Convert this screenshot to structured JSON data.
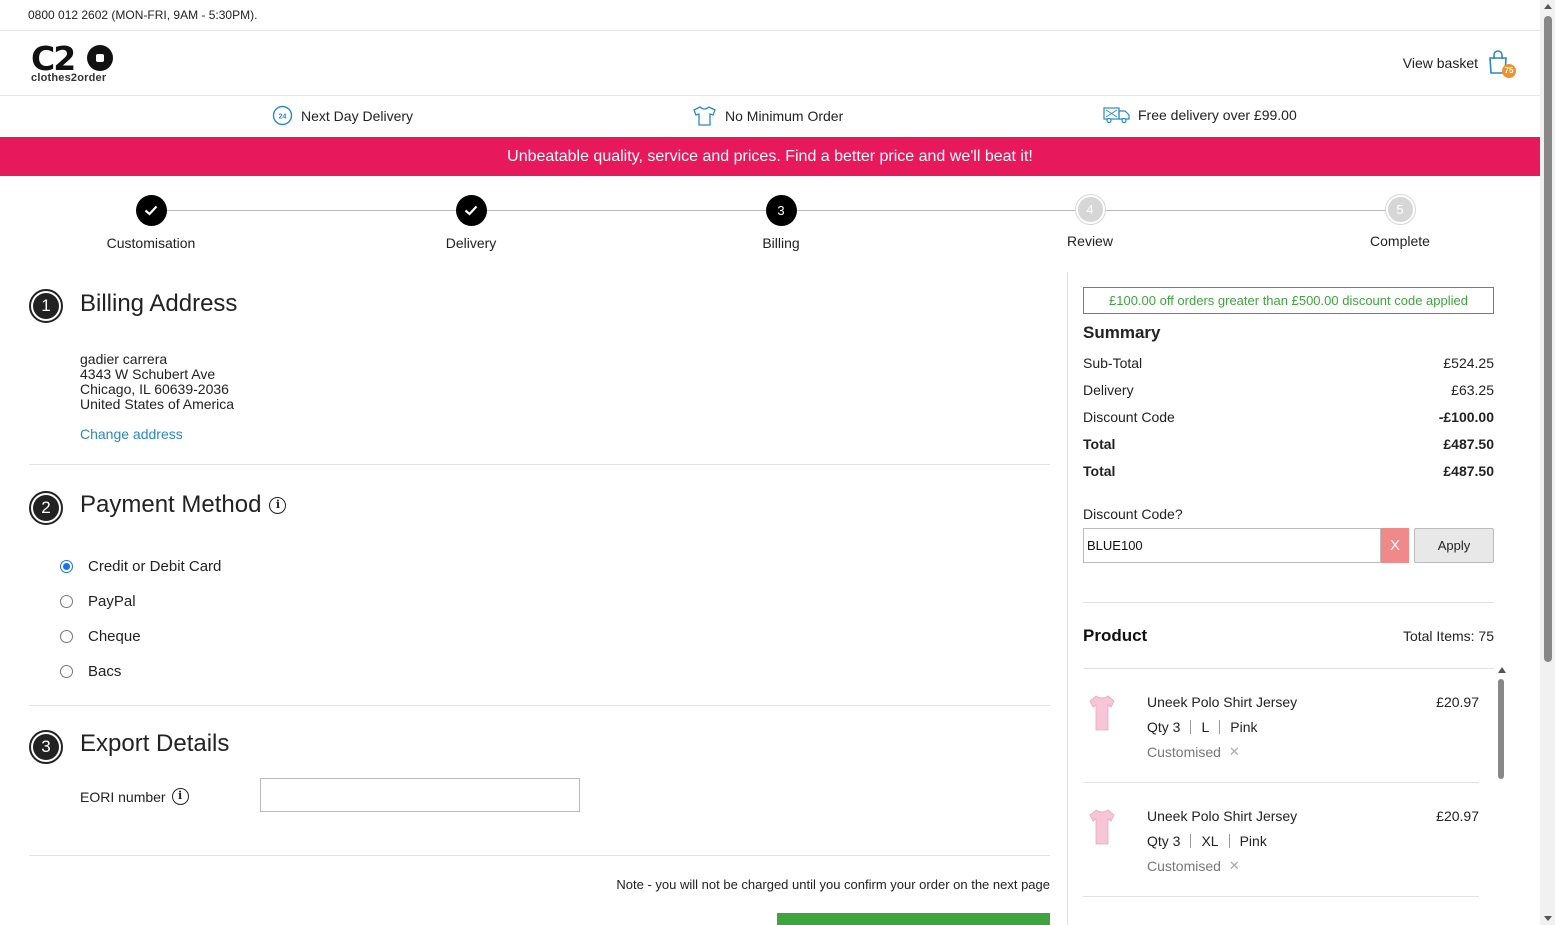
{
  "topbar": {
    "phone": "0800 012 2602 (MON-FRI, 9AM - 5:30PM)."
  },
  "header": {
    "logo_mark": "C20",
    "logo_sub": "clothes2order",
    "basket_label": "View basket",
    "basket_count": "75"
  },
  "usps": [
    {
      "label": "Next Day Delivery",
      "icon": "24h-delivery-icon"
    },
    {
      "label": "No Minimum Order",
      "icon": "tshirt-icon"
    },
    {
      "label": "Free delivery over £99.00",
      "icon": "delivery-truck-icon"
    }
  ],
  "banner": {
    "text": "Unbeatable quality, service and prices. Find a better price and we'll beat it!",
    "color": "#e8185c"
  },
  "steps": [
    {
      "num": "",
      "label": "Customisation",
      "state": "done"
    },
    {
      "num": "",
      "label": "Delivery",
      "state": "done"
    },
    {
      "num": "3",
      "label": "Billing",
      "state": "active"
    },
    {
      "num": "4",
      "label": "Review",
      "state": "todo"
    },
    {
      "num": "5",
      "label": "Complete",
      "state": "todo"
    }
  ],
  "billing": {
    "num": "1",
    "title": "Billing Address",
    "address": [
      "gadier carrera",
      "4343 W Schubert Ave",
      "Chicago, IL 60639-2036",
      "United States of America"
    ],
    "change_link": "Change address"
  },
  "payment": {
    "num": "2",
    "title": "Payment Method",
    "options": [
      {
        "label": "Credit or Debit Card",
        "checked": true
      },
      {
        "label": "PayPal",
        "checked": false
      },
      {
        "label": "Cheque",
        "checked": false
      },
      {
        "label": "Bacs",
        "checked": false
      }
    ]
  },
  "export": {
    "num": "3",
    "title": "Export Details",
    "eori_label": "EORI number",
    "eori_value": ""
  },
  "note": "Note - you will not be charged until you confirm your order on the next page",
  "summary": {
    "promo": "£100.00 off orders greater than £500.00 discount code applied",
    "title": "Summary",
    "rows": [
      {
        "label": "Sub-Total",
        "value": "£524.25",
        "bold": false
      },
      {
        "label": "Delivery",
        "value": "£63.25",
        "bold": false
      },
      {
        "label": "Discount Code",
        "value": "-£100.00",
        "bold": false
      },
      {
        "label": "Total",
        "value": "£487.50",
        "bold": true
      },
      {
        "label": "Total",
        "value": "£487.50",
        "bold": true
      }
    ],
    "discount_label": "Discount Code?",
    "discount_value": "BLUE100",
    "discount_clear": "X",
    "apply_label": "Apply"
  },
  "products": {
    "title": "Product",
    "total_items": "Total Items: 75",
    "items": [
      {
        "name": "Uneek Polo Shirt Jersey",
        "price": "£20.97",
        "qty": "Qty 3",
        "size": "L",
        "color": "Pink",
        "custom": "Customised",
        "remove": "✕"
      },
      {
        "name": "Uneek Polo Shirt Jersey",
        "price": "£20.97",
        "qty": "Qty 3",
        "size": "XL",
        "color": "Pink",
        "custom": "Customised",
        "remove": "✕"
      }
    ]
  },
  "colors": {
    "accent_green": "#3ea53e",
    "link_blue": "#2a88c8",
    "banner_pink": "#e8185c"
  }
}
